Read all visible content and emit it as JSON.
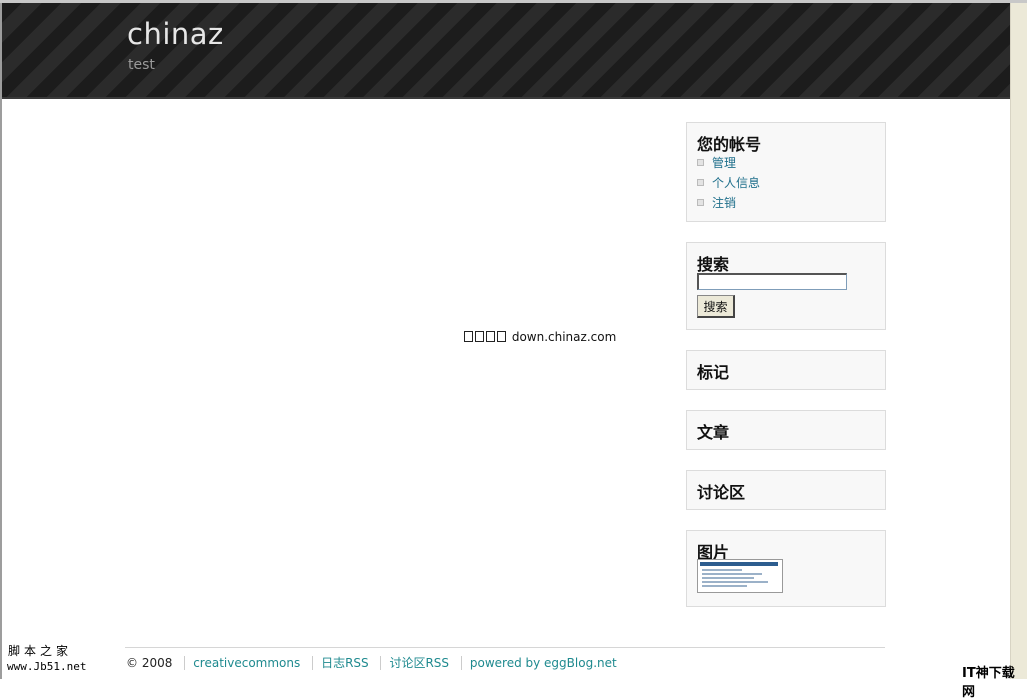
{
  "header": {
    "title": "chinaz",
    "subtitle": "test"
  },
  "center_text": "down.chinaz.com",
  "sidebar": {
    "account": {
      "title": "您的帐号",
      "items": [
        "管理",
        "个人信息",
        "注销"
      ]
    },
    "search": {
      "title": "搜索",
      "input_value": "",
      "button_label": "搜索"
    },
    "tags": {
      "title": "标记"
    },
    "articles": {
      "title": "文章"
    },
    "forum": {
      "title": "讨论区"
    },
    "images": {
      "title": "图片"
    }
  },
  "footer": {
    "copyright": "© 2008",
    "links": [
      "creativecommons",
      "日志RSS",
      "讨论区RSS",
      "powered by eggBlog.net"
    ]
  },
  "watermarks": {
    "left_top": "脚本之家",
    "left_bottom": "www.Jb51.net",
    "right": "IT神下载网"
  },
  "colors": {
    "link": "#1f8a8f",
    "header_bg": "#1c1c1c"
  }
}
